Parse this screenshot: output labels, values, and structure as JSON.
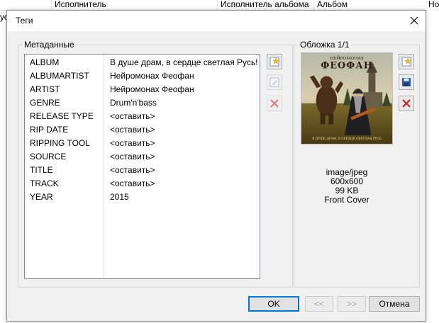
{
  "background": {
    "columns": [
      "Исполнитель",
      "Исполнитель альбома",
      "Альбом"
    ],
    "left_text": "Русь",
    "right_text": "Но"
  },
  "dialog": {
    "title": "Теги",
    "close_icon": "close-icon"
  },
  "metadata": {
    "legend": "Метаданные",
    "rows": [
      {
        "key": "ALBUM",
        "value": "В душе драм, в сердце светлая Русь!"
      },
      {
        "key": "ALBUMARTIST",
        "value": "Нейромонах Феофан"
      },
      {
        "key": "ARTIST",
        "value": "Нейромонах Феофан"
      },
      {
        "key": "GENRE",
        "value": "Drum'n'bass"
      },
      {
        "key": "RELEASE TYPE",
        "value": "<оставить>"
      },
      {
        "key": "RIP DATE",
        "value": "<оставить>"
      },
      {
        "key": "RIPPING TOOL",
        "value": "<оставить>"
      },
      {
        "key": "SOURCE",
        "value": "<оставить>"
      },
      {
        "key": "TITLE",
        "value": "<оставить>"
      },
      {
        "key": "TRACK",
        "value": "<оставить>"
      },
      {
        "key": "YEAR",
        "value": "2015"
      }
    ],
    "tools": [
      "add-field-icon",
      "edit-field-icon",
      "remove-field-icon"
    ]
  },
  "cover": {
    "legend": "Обложка 1/1",
    "art_lettering_top": "НЕЙРОМОНАХ",
    "art_lettering_main": "ФЕОФАН",
    "art_lettering_bottom": "В ДУШЕ ДРАМ, В СЕРДЦЕ СВЕТЛАЯ РУСЬ",
    "info": {
      "mime": "image/jpeg",
      "dimensions": "600x600",
      "size": "99 KB",
      "type": "Front Cover"
    },
    "tools": [
      "add-cover-icon",
      "save-cover-icon",
      "remove-cover-icon"
    ]
  },
  "buttons": {
    "ok": "OK",
    "prev": "<<",
    "next": ">>",
    "cancel": "Отмена"
  }
}
